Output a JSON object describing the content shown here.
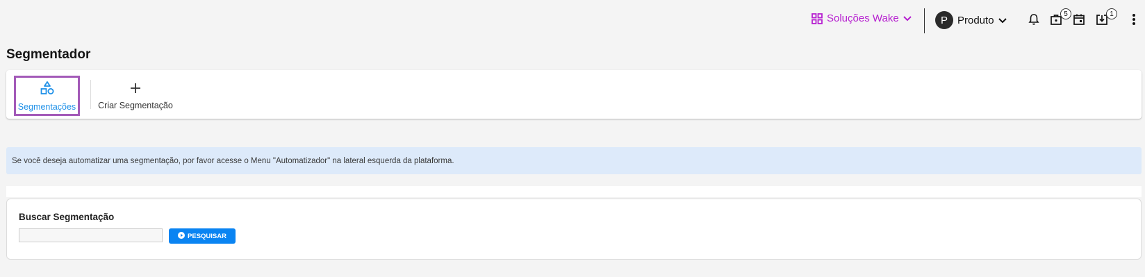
{
  "header": {
    "solutions_label": "Soluções Wake",
    "solutions_icon": "grid-icon",
    "account_initial": "P",
    "account_label": "Produto",
    "icons": [
      "bell-icon",
      "briefcase-icon",
      "calendar-icon",
      "download-tray-icon",
      "more-vert-icon"
    ],
    "briefcase_badge": "5",
    "download_badge": "1",
    "accent_color": "#b61fd0"
  },
  "page": {
    "title": "Segmentador"
  },
  "tabs": [
    {
      "label": "Segmentações",
      "icon": "shapes-icon",
      "active": true
    },
    {
      "label": "Criar Segmentação",
      "icon": "plus-icon",
      "active": false
    }
  ],
  "info": {
    "text": "Se você deseja automatizar uma segmentação, por favor acesse o Menu \"Automatizador\" na lateral esquerda da plataforma."
  },
  "search": {
    "title": "Buscar Segmentação",
    "input_value": "",
    "button_label": "PESQUISAR",
    "button_color": "#0a84f2"
  }
}
